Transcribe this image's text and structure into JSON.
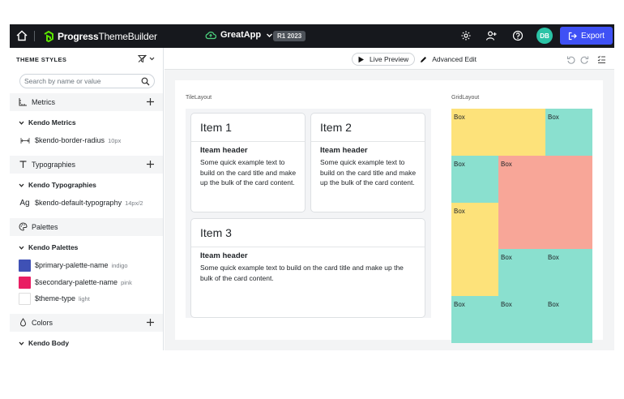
{
  "topbar": {
    "brand_bold": "Progress",
    "brand_light": "ThemeBuilder",
    "app_name": "GreatApp",
    "release_badge": "R1 2023",
    "avatar_initials": "DB",
    "export_label": "Export"
  },
  "sidebar": {
    "title": "THEME STYLES",
    "search_placeholder": "Search by name or value",
    "sections": {
      "metrics": "Metrics",
      "typographies": "Typographies",
      "palettes": "Palettes",
      "colors": "Colors"
    },
    "groups": {
      "metrics": "Kendo Metrics",
      "typographies": "Kendo Typographies",
      "palettes": "Kendo Palettes",
      "colors": "Kendo Body"
    },
    "items": [
      {
        "icon": "border-radius-icon",
        "name": "$kendo-border-radius",
        "value": "10px"
      },
      {
        "icon": "typography-icon",
        "name": "$kendo-default-typography",
        "value": "14px/2"
      },
      {
        "icon": "swatch",
        "name": "$primary-palette-name",
        "value": "indigo",
        "color": "#3f51b5"
      },
      {
        "icon": "swatch",
        "name": "$secondary-palette-name",
        "value": "pink",
        "color": "#e91e63"
      },
      {
        "icon": "swatch",
        "name": "$theme-type",
        "value": "light",
        "color": "#ffffff"
      }
    ]
  },
  "toolbar": {
    "live_preview": "Live Preview",
    "advanced_edit": "Advanced Edit"
  },
  "preview": {
    "tile_label": "TileLayout",
    "grid_label": "GridLayout",
    "cards": [
      {
        "title": "Item 1",
        "header": "Iteam header",
        "text": "Some quick example text to build on the card title and make up the bulk of the card content."
      },
      {
        "title": "Item 2",
        "header": "Iteam header",
        "text": "Some quick example text to build on the card title and make up the bulk of the card content."
      },
      {
        "title": "Item 3",
        "header": "Iteam header",
        "text": "Some quick example text to build on the card title and make up the bulk of the card content."
      }
    ],
    "box_label": "Box",
    "colors": {
      "yellow": "#fde27a",
      "teal": "#8ae0cf",
      "salmon": "#f8a698"
    }
  }
}
